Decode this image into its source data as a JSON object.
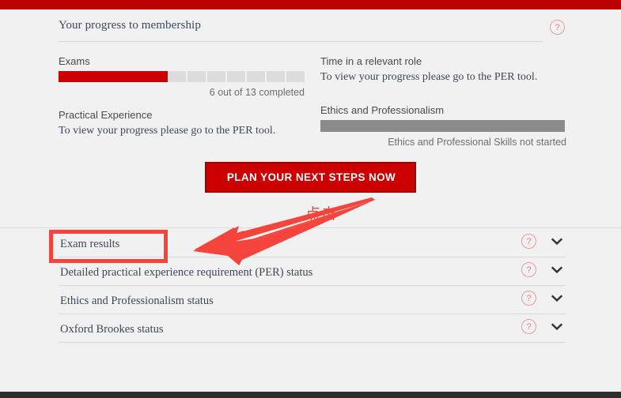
{
  "brand": {
    "bar_color": "#bd0000",
    "accent_red": "#cc0000"
  },
  "panel": {
    "title": "Your progress to membership",
    "help_icon": "?",
    "help_icon_name": "help-question-icon"
  },
  "progress": {
    "left_column": [
      {
        "label": "Exams",
        "type": "segmented-bar",
        "total_segments": 13,
        "completed_segments": 6,
        "caption": "6 out of 13 completed"
      },
      {
        "label": "Practical Experience",
        "type": "text",
        "note": "To view your progress please go to the PER tool."
      }
    ],
    "right_column": [
      {
        "label": "Time in a relevant role",
        "type": "text",
        "note": "To view your progress please go to the PER tool."
      },
      {
        "label": "Ethics and Professionalism",
        "type": "solid-bar",
        "bar_color": "#8c8a8a",
        "caption": "Ethics and Professional Skills not started"
      }
    ]
  },
  "cta": {
    "label": "PLAN YOUR NEXT STEPS NOW"
  },
  "accordion": {
    "rows": [
      {
        "label": "Exam results",
        "help_icon": "?",
        "chevron": "chevron-down"
      },
      {
        "label": "Detailed practical experience requirement (PER) status",
        "help_icon": "?",
        "chevron": "chevron-down"
      },
      {
        "label": "Ethics and Professionalism status",
        "help_icon": "?",
        "chevron": "chevron-down"
      },
      {
        "label": "Oxford Brookes status",
        "help_icon": "?",
        "chevron": "chevron-down"
      }
    ]
  },
  "annotation": {
    "text": "点击",
    "color": "#f4443c",
    "highlight_target": "Exam results"
  }
}
